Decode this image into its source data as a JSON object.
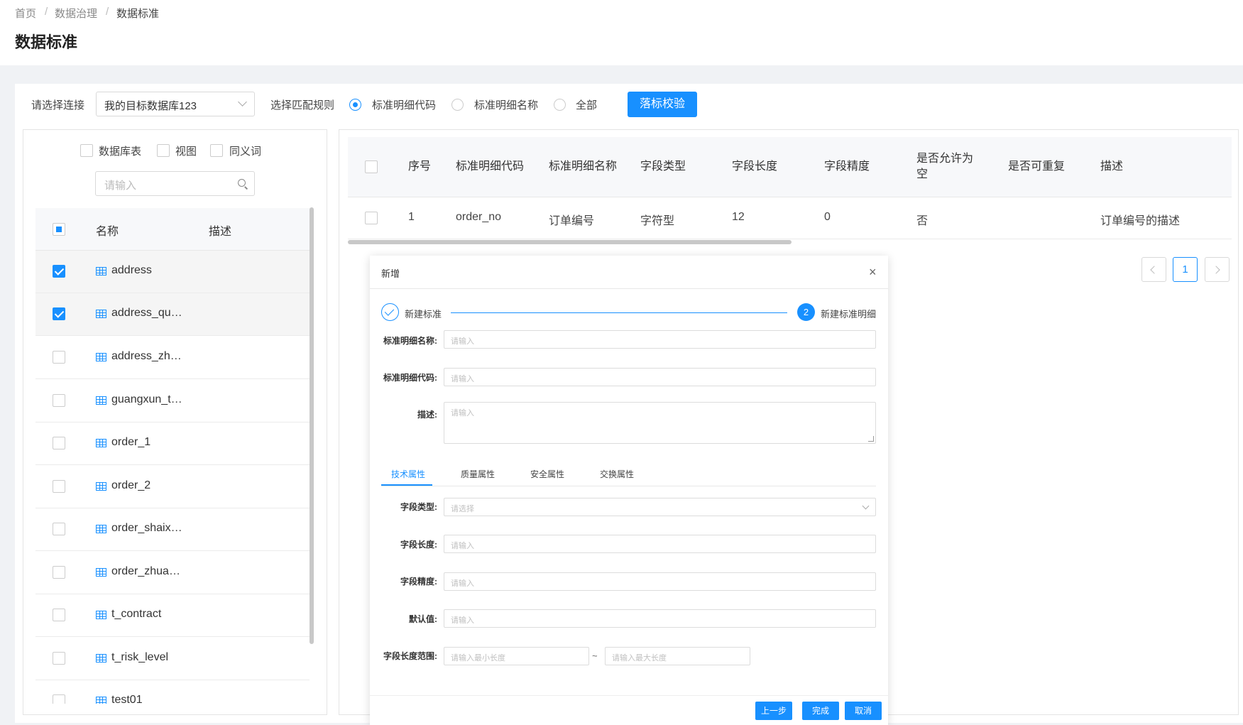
{
  "breadcrumb": [
    "首页",
    "数据治理",
    "数据标准"
  ],
  "page_title": "数据标准",
  "toolbar": {
    "connection_label": "请选择连接",
    "connection_value": "我的目标数据库123",
    "match_rule_label": "选择匹配规则",
    "rules": [
      {
        "label": "标准明细代码",
        "selected": true
      },
      {
        "label": "标准明细名称",
        "selected": false
      },
      {
        "label": "全部",
        "selected": false
      }
    ],
    "verify_button": "落标校验"
  },
  "left": {
    "filters": [
      {
        "label": "数据库表",
        "checked": false
      },
      {
        "label": "视图",
        "checked": false
      },
      {
        "label": "同义词",
        "checked": false
      }
    ],
    "search_placeholder": "请输入",
    "columns": {
      "name": "名称",
      "desc": "描述"
    },
    "rows": [
      {
        "name": "address",
        "checked": true
      },
      {
        "name": "address_qu…",
        "checked": true
      },
      {
        "name": "address_zh…",
        "checked": false
      },
      {
        "name": "guangxun_t…",
        "checked": false
      },
      {
        "name": "order_1",
        "checked": false
      },
      {
        "name": "order_2",
        "checked": false
      },
      {
        "name": "order_shaix…",
        "checked": false
      },
      {
        "name": "order_zhua…",
        "checked": false
      },
      {
        "name": "t_contract",
        "checked": false
      },
      {
        "name": "t_risk_level",
        "checked": false
      },
      {
        "name": "test01",
        "checked": false
      }
    ]
  },
  "grid": {
    "headers": [
      "序号",
      "标准明细代码",
      "标准明细名称",
      "字段类型",
      "字段长度",
      "字段精度",
      "是否允许为空",
      "是否可重复",
      "描述"
    ],
    "rows": [
      {
        "index": "1",
        "code": "order_no",
        "name": "订单编号",
        "type": "字符型",
        "length": "12",
        "precision": "0",
        "nullable": "否",
        "repeatable": "",
        "desc": "订单编号的描述"
      }
    ],
    "pages": [
      "1"
    ]
  },
  "dialog": {
    "title": "新增",
    "steps": [
      "新建标准",
      "新建标准明细"
    ],
    "step2_number": "2",
    "fields": [
      {
        "label": "标准明细名称:",
        "placeholder": "请输入"
      },
      {
        "label": "标准明细代码:",
        "placeholder": "请输入"
      },
      {
        "label": "描述:",
        "placeholder": "请输入"
      }
    ],
    "tabs": [
      "技术属性",
      "质量属性",
      "安全属性",
      "交换属性"
    ],
    "tech_fields": [
      {
        "label": "字段类型:",
        "placeholder": "请选择"
      },
      {
        "label": "字段长度:",
        "placeholder": "请输入"
      },
      {
        "label": "字段精度:",
        "placeholder": "请输入"
      },
      {
        "label": "默认值:",
        "placeholder": "请输入"
      }
    ],
    "range": {
      "label": "字段长度范围:",
      "min_placeholder": "请输入最小长度",
      "sep": "~",
      "max_placeholder": "请输入最大长度"
    },
    "buttons": {
      "prev": "上一步",
      "finish": "完成",
      "cancel": "取消"
    }
  }
}
